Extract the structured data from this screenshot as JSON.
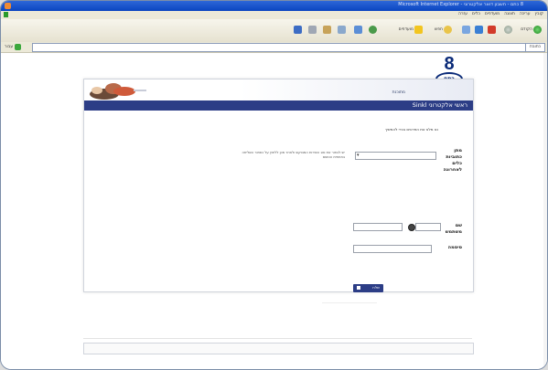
{
  "window": {
    "title": "8 כתם - חשבון דואר אלקטרוני - Microsoft Internet Explorer"
  },
  "menubar": {
    "items": [
      "קובץ",
      "עריכה",
      "תצוגה",
      "מועדפים",
      "כלים",
      "עזרה"
    ]
  },
  "toolbar": {
    "back_label": "הקודם",
    "search_label": "חפש",
    "favorites_label": "מועדפים"
  },
  "addressbar": {
    "label": "כתובת",
    "go_label": "עבור",
    "value": ""
  },
  "logo": {
    "number": "8",
    "text": "כתם"
  },
  "panel": {
    "caption": "מתוכנת",
    "header_title": "ראשי אלקטרוני Sinkl",
    "instruction": "נא מלא את הפרטים בכדי להמשיך",
    "form": {
      "field1_label": "מתן כתוביות כלים לאחרונה",
      "field1_value": "",
      "hint": "יש לבחור את סוג השירות המבוקש ולאחר מכן ללחוץ על כפתור השליחה בתחתית הטופס",
      "field2_label": "שם משתמש",
      "field3_label": "סיסמה",
      "submit_label": "שלח"
    }
  },
  "colors": {
    "brand_blue": "#2c3d86",
    "titlebar_blue": "#1553c9"
  }
}
